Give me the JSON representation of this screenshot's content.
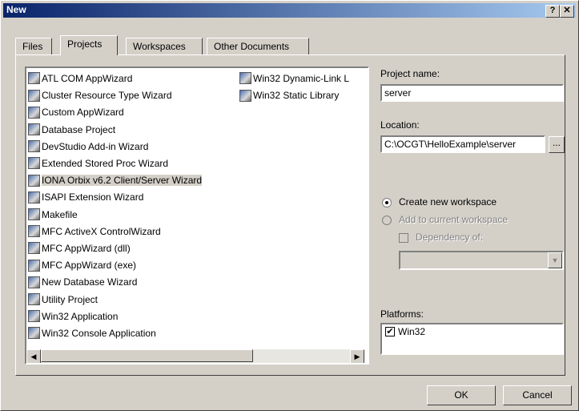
{
  "window": {
    "title": "New",
    "help_label": "?",
    "close_label": "✕"
  },
  "tabs": [
    "Files",
    "Projects",
    "Workspaces",
    "Other Documents"
  ],
  "project_types": [
    {
      "label": "ATL COM AppWizard",
      "icon": "atl-com-icon"
    },
    {
      "label": "Cluster Resource Type Wizard",
      "icon": "cluster-icon"
    },
    {
      "label": "Custom AppWizard",
      "icon": "custom-wizard-icon"
    },
    {
      "label": "Database Project",
      "icon": "database-icon"
    },
    {
      "label": "DevStudio Add-in Wizard",
      "icon": "addin-icon"
    },
    {
      "label": "Extended Stored Proc Wizard",
      "icon": "stored-proc-icon"
    },
    {
      "label": "IONA Orbix v6.2 Client/Server Wizard",
      "icon": "iona-orbix-icon"
    },
    {
      "label": "ISAPI Extension Wizard",
      "icon": "isapi-icon"
    },
    {
      "label": "Makefile",
      "icon": "makefile-icon"
    },
    {
      "label": "MFC ActiveX ControlWizard",
      "icon": "mfc-activex-icon"
    },
    {
      "label": "MFC AppWizard (dll)",
      "icon": "mfc-dll-icon"
    },
    {
      "label": "MFC AppWizard (exe)",
      "icon": "mfc-exe-icon"
    },
    {
      "label": "New Database Wizard",
      "icon": "new-database-icon"
    },
    {
      "label": "Utility Project",
      "icon": "utility-icon"
    },
    {
      "label": "Win32 Application",
      "icon": "win32-app-icon"
    },
    {
      "label": "Win32 Console Application",
      "icon": "console-icon"
    },
    {
      "label": "Win32 Dynamic-Link L",
      "icon": "dll-icon"
    },
    {
      "label": "Win32 Static Library",
      "icon": "static-lib-icon"
    }
  ],
  "selected_index": 6,
  "form": {
    "project_name_label": "Project name:",
    "project_name_value": "server",
    "location_label": "Location:",
    "location_value": "C:\\OCGT\\HelloExample\\server",
    "browse_label": "...",
    "create_workspace_label": "Create new workspace",
    "add_workspace_label": "Add to current workspace",
    "dependency_label": "Dependency of:",
    "dependency_value": "",
    "platforms_label": "Platforms:",
    "platforms": [
      {
        "label": "Win32",
        "checked": true
      }
    ]
  },
  "buttons": {
    "ok": "OK",
    "cancel": "Cancel"
  },
  "colors": {
    "title_start": "#0a246a",
    "title_end": "#a6caf0",
    "face": "#d4d0c8"
  }
}
